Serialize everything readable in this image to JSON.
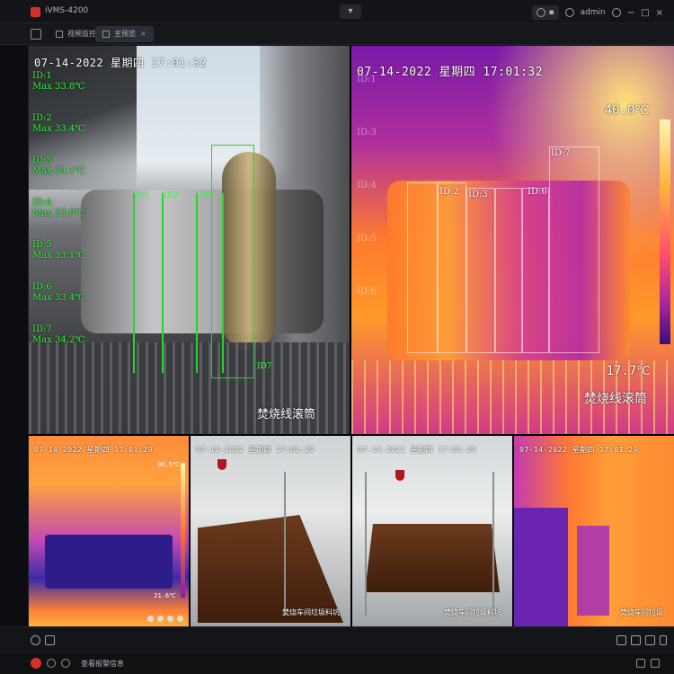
{
  "app": {
    "title": "iVMS-4200"
  },
  "titlebar": {
    "user_label": "admin",
    "window_buttons": [
      "−",
      "□",
      "×"
    ]
  },
  "tabs": [
    {
      "label": "视频监控"
    },
    {
      "label": "主预览"
    }
  ],
  "main_pane": {
    "osd": "07-14-2022 星期四 17:01:32",
    "camera_name": "焚烧线滚筒",
    "ids": [
      {
        "id": "ID:1",
        "max": "Max 33.8℃"
      },
      {
        "id": "ID:2",
        "max": "Max 33.4℃"
      },
      {
        "id": "ID:3",
        "max": "Max 34.1℃"
      },
      {
        "id": "ID:4",
        "max": "Max 33.0℃"
      },
      {
        "id": "ID:5",
        "max": "Max 33.1℃"
      },
      {
        "id": "ID:6",
        "max": "Max 33.4℃"
      },
      {
        "id": "ID:7",
        "max": "Max 34.2℃"
      }
    ]
  },
  "thermal_pane": {
    "osd": "07-14-2022 星期四 17:01:32",
    "camera_name": "焚烧线滚筒",
    "temp_max": "40.0℃",
    "temp_min": "17.7℃",
    "box_labels": [
      "ID:1",
      "ID:2",
      "ID:3",
      "ID:4",
      "ID:5",
      "ID:6",
      "ID:7"
    ]
  },
  "small_panes": [
    {
      "osd": "07-14-2022 星期四 17:01:29",
      "camera_name": "",
      "temp_max": "30.5℃",
      "temp_min": "21.6℃"
    },
    {
      "osd": "07-14-2022 星期四 17:01:29",
      "camera_name": "焚烧车间垃圾料坑"
    },
    {
      "osd": "07-14-2022 星期四 17:01:29",
      "camera_name": "焚烧车间垃圾料坑"
    },
    {
      "osd": "07-14-2022 星期四 17:01:29",
      "camera_name": "焚烧车间垃圾"
    }
  ],
  "statusbar": {
    "text": "查看报警信息"
  },
  "colors": {
    "accent": "#d5312c",
    "osd_green": "#2cff33"
  }
}
